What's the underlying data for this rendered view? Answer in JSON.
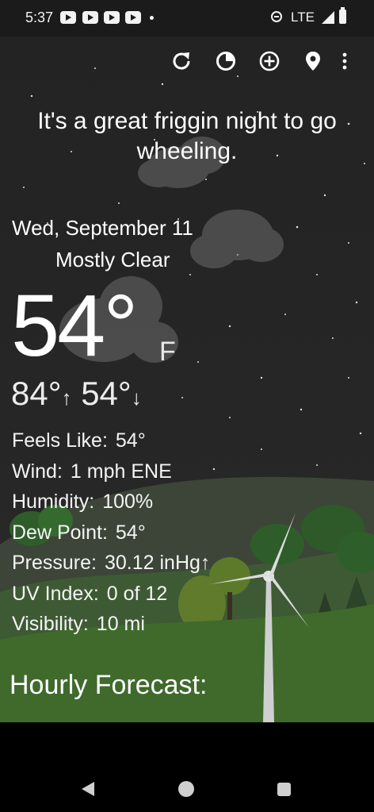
{
  "status_bar": {
    "time": "5:37",
    "network": "LTE",
    "notification_icons": [
      "youtube-icon",
      "youtube-icon",
      "youtube-icon",
      "youtube-icon"
    ]
  },
  "toolbar": {
    "icons": [
      "refresh-icon",
      "radar-icon",
      "add-location-icon",
      "location-pin-icon",
      "more-vert-icon"
    ]
  },
  "weather": {
    "tagline": "It's a great friggin night to go wheeling.",
    "date": "Wed, September 11",
    "condition": "Mostly Clear",
    "condition_icon": "crescent-moon-icon",
    "temperature": "54°",
    "unit": "F",
    "high": "84°",
    "low": "54°",
    "details": [
      {
        "label": "Feels Like:",
        "value": "54°"
      },
      {
        "label": "Wind:",
        "value": "1 mph ENE"
      },
      {
        "label": "Humidity:",
        "value": "100%"
      },
      {
        "label": "Dew Point:",
        "value": "54°"
      },
      {
        "label": "Pressure:",
        "value": "30.12 inHg↑"
      },
      {
        "label": "UV Index:",
        "value": "0 of 12"
      },
      {
        "label": "Visibility:",
        "value": "10 mi"
      }
    ]
  },
  "hourly": {
    "title": "Hourly Forecast:"
  },
  "colors": {
    "moon": "#3a78ff",
    "text": "#ffffff",
    "background": "#232323"
  }
}
